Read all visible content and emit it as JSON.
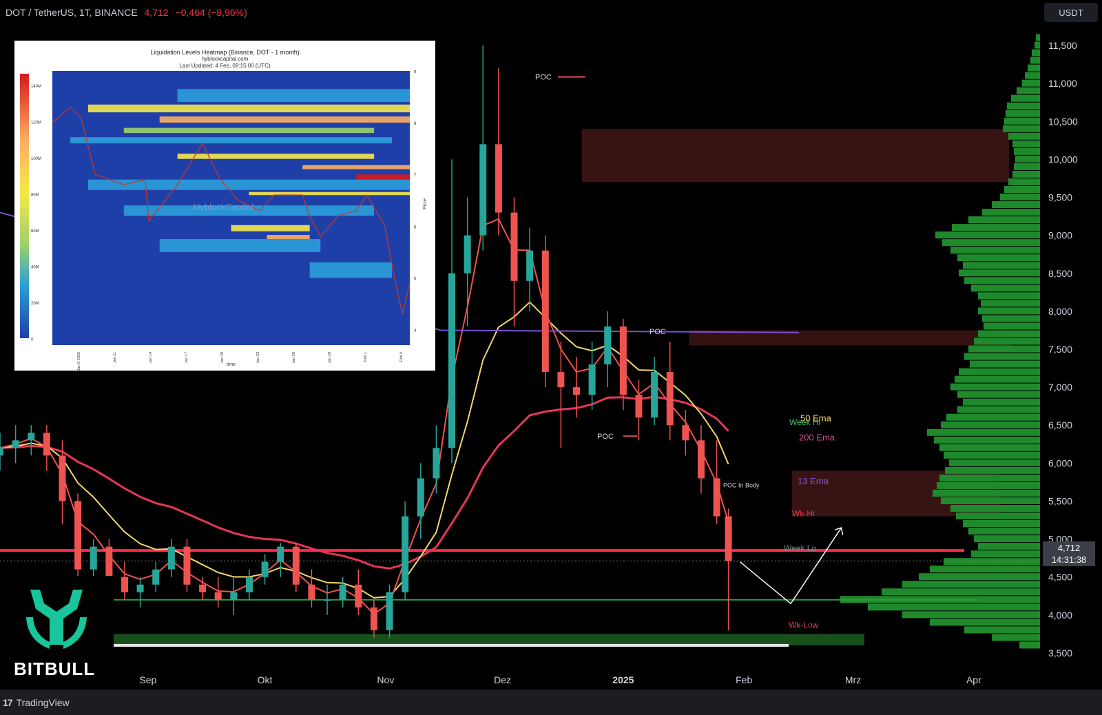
{
  "header": {
    "symbol": "DOT / TetherUS, 1T, BINANCE",
    "last": "4,712",
    "change": "−0,464 (−8,96%)"
  },
  "currency_button": "USDT",
  "price_tag": {
    "price": "4,712",
    "countdown": "14:31:38"
  },
  "footer": {
    "logo_glyph": "17",
    "brand": "TradingView"
  },
  "watermark": {
    "brand": "BITBULL",
    "logo_icon": "bitbull-logo-icon"
  },
  "colors": {
    "bg": "#000000",
    "up": "#26a69a",
    "down": "#ef5350",
    "ema50": "#f4d76b",
    "ema200": "#e8355a",
    "ma_purple": "#7b4fd1",
    "profile": "#1f8a2c",
    "resistance_zone": "#4a1a1a",
    "support_line": "#2e9e3a",
    "horizontal_red": "#ff2a4a"
  },
  "chart_data": [
    {
      "type": "candlestick",
      "title": "DOT / TetherUS, 1T, BINANCE",
      "x_tick_labels": [
        "Sep",
        "Okt",
        "Nov",
        "Dez",
        "2025",
        "Feb",
        "Mrz",
        "Apr"
      ],
      "y_tick_labels": [
        "11,500",
        "11,000",
        "10,500",
        "10,000",
        "9,500",
        "9,000",
        "8,500",
        "8,000",
        "7,500",
        "7,000",
        "6,500",
        "6,000",
        "5,500",
        "5,000",
        "4,500",
        "4,000",
        "3,500"
      ],
      "ylim": [
        3.3,
        11.7
      ],
      "xlim": [
        "2024-08-01",
        "2025-04-25"
      ],
      "last_price": 4.712,
      "series": [
        {
          "name": "DOT/USDT",
          "ohlc_approx": [
            [
              "2024-08-01",
              6.1,
              6.4,
              5.9,
              6.2
            ],
            [
              "2024-08-05",
              6.2,
              6.5,
              6.0,
              6.3
            ],
            [
              "2024-08-09",
              6.3,
              6.5,
              6.1,
              6.4
            ],
            [
              "2024-08-13",
              6.4,
              6.5,
              5.9,
              6.1
            ],
            [
              "2024-08-17",
              6.1,
              6.3,
              5.2,
              5.5
            ],
            [
              "2024-08-21",
              5.5,
              5.6,
              4.4,
              4.6
            ],
            [
              "2024-08-25",
              4.6,
              5.0,
              4.4,
              4.9
            ],
            [
              "2024-08-29",
              4.9,
              5.0,
              4.4,
              4.5
            ],
            [
              "2024-09-02",
              4.5,
              4.7,
              4.2,
              4.3
            ],
            [
              "2024-09-06",
              4.3,
              4.5,
              4.1,
              4.4
            ],
            [
              "2024-09-10",
              4.4,
              4.7,
              4.3,
              4.6
            ],
            [
              "2024-09-14",
              4.6,
              5.0,
              4.5,
              4.9
            ],
            [
              "2024-09-18",
              4.9,
              5.0,
              4.3,
              4.4
            ],
            [
              "2024-09-22",
              4.4,
              4.5,
              4.2,
              4.3
            ],
            [
              "2024-09-26",
              4.3,
              4.5,
              4.1,
              4.2
            ],
            [
              "2024-09-30",
              4.2,
              4.5,
              4.0,
              4.3
            ],
            [
              "2024-10-04",
              4.3,
              4.6,
              4.2,
              4.5
            ],
            [
              "2024-10-08",
              4.5,
              4.8,
              4.4,
              4.7
            ],
            [
              "2024-10-12",
              4.7,
              4.95,
              4.5,
              4.9
            ],
            [
              "2024-10-16",
              4.9,
              4.95,
              4.3,
              4.4
            ],
            [
              "2024-10-20",
              4.4,
              4.6,
              4.1,
              4.2
            ],
            [
              "2024-10-24",
              4.2,
              4.4,
              4.0,
              4.2
            ],
            [
              "2024-10-28",
              4.2,
              4.5,
              4.1,
              4.4
            ],
            [
              "2024-11-01",
              4.4,
              4.6,
              4.0,
              4.1
            ],
            [
              "2024-11-05",
              4.1,
              4.2,
              3.7,
              3.8
            ],
            [
              "2024-11-09",
              3.8,
              4.4,
              3.7,
              4.3
            ],
            [
              "2024-11-13",
              4.3,
              5.5,
              4.2,
              5.3
            ],
            [
              "2024-11-17",
              5.3,
              6.0,
              5.0,
              5.8
            ],
            [
              "2024-11-21",
              5.8,
              6.5,
              5.6,
              6.2
            ],
            [
              "2024-11-25",
              6.2,
              10.0,
              6.0,
              8.5
            ],
            [
              "2024-11-29",
              8.5,
              9.5,
              7.8,
              9.0
            ],
            [
              "2024-12-03",
              9.0,
              11.5,
              8.8,
              10.2
            ],
            [
              "2024-12-07",
              10.2,
              11.2,
              9.0,
              9.3
            ],
            [
              "2024-12-11",
              9.3,
              9.5,
              7.8,
              8.4
            ],
            [
              "2024-12-15",
              8.4,
              9.1,
              8.0,
              8.8
            ],
            [
              "2024-12-19",
              8.8,
              9.0,
              7.0,
              7.2
            ],
            [
              "2024-12-23",
              7.2,
              7.6,
              6.2,
              7.0
            ],
            [
              "2024-12-27",
              7.0,
              7.4,
              6.6,
              6.9
            ],
            [
              "2024-12-31",
              6.9,
              7.6,
              6.7,
              7.3
            ],
            [
              "2025-01-04",
              7.3,
              8.0,
              7.0,
              7.8
            ],
            [
              "2025-01-08",
              7.8,
              7.9,
              6.7,
              6.9
            ],
            [
              "2025-01-12",
              6.9,
              7.1,
              6.3,
              6.6
            ],
            [
              "2025-01-16",
              6.6,
              7.4,
              6.5,
              7.2
            ],
            [
              "2025-01-20",
              7.2,
              7.6,
              6.3,
              6.5
            ],
            [
              "2025-01-24",
              6.5,
              6.7,
              6.1,
              6.3
            ],
            [
              "2025-01-28",
              6.3,
              6.5,
              5.6,
              5.8
            ],
            [
              "2025-02-01",
              5.8,
              6.3,
              5.2,
              5.3
            ],
            [
              "2025-02-04",
              5.3,
              5.4,
              3.8,
              4.712
            ]
          ]
        },
        {
          "name": "50 Ema",
          "color": "#f4d76b"
        },
        {
          "name": "200 Ema",
          "color": "#e8355a"
        },
        {
          "name": "13 Ema",
          "color": "#ef3b4b"
        }
      ],
      "annotations": [
        "POC",
        "POC",
        "POC",
        "POC In Body",
        "Week Hi",
        "Week Lo",
        "Wk-Hi",
        "Wk-Low",
        "50 Ema",
        "200 Ema",
        "13 Ema"
      ],
      "levels": {
        "red_line": 4.85,
        "green_support": 4.2,
        "resistance_zone_top": [
          9.7,
          10.4
        ],
        "resistance_zone_mid": [
          5.3,
          5.9
        ],
        "resistance_band": [
          7.55,
          7.75
        ],
        "support_zone": [
          3.6,
          3.75
        ]
      },
      "projection_path": [
        [
          "2025-02-07",
          4.7
        ],
        [
          "2025-02-20",
          4.15
        ],
        [
          "2025-03-05",
          5.15
        ]
      ]
    },
    {
      "type": "heatmap",
      "title": "Liquidation Levels Heatmap (Binance, DOT - 1 month)",
      "subtitle": [
        "hyblockcapital.com",
        "Last Updated: 4 Feb, 09:15:00 (UTC)"
      ],
      "watermark": "HyblockCapital",
      "xlabel": "time",
      "ylabel": "Price",
      "x_tick_labels": [
        "Jan 8\n2025",
        "Jan 11",
        "Jan 14",
        "Jan 17",
        "Jan 20",
        "Jan 23",
        "Jan 26",
        "Jan 29",
        "Feb 1",
        "Feb 4"
      ],
      "y_tick_labels": [
        "9",
        "8",
        "7",
        "6",
        "5",
        "4"
      ],
      "colorbar_labels": [
        "140M",
        "120M",
        "100M",
        "80M",
        "60M",
        "40M",
        "20M",
        "0"
      ],
      "ylim": [
        3.7,
        9.0
      ]
    }
  ]
}
